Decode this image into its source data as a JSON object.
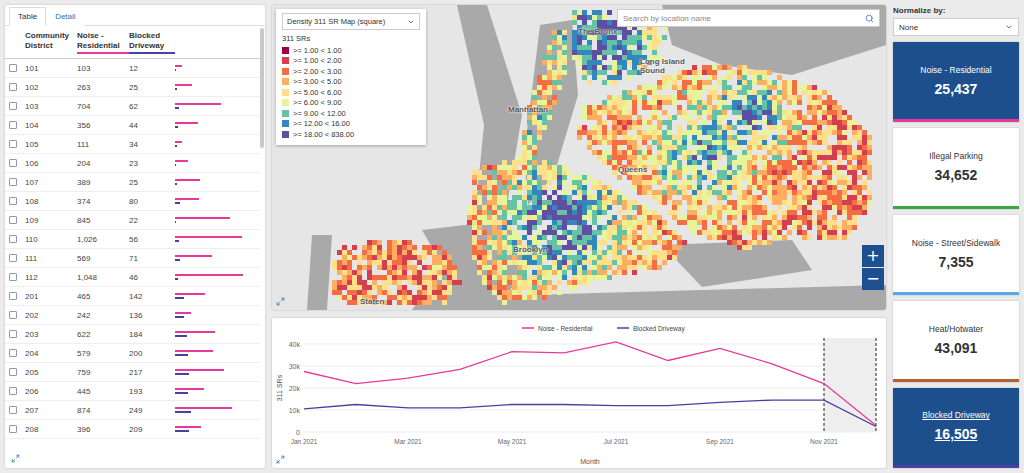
{
  "left_panel": {
    "tabs": [
      {
        "label": "Table",
        "selected": true
      },
      {
        "label": "Detail",
        "selected": false
      }
    ]
  },
  "table": {
    "columns": [
      {
        "label": "Community District"
      },
      {
        "label": "Noise - Residential",
        "color": "#e8399b"
      },
      {
        "label": "Blocked Driveway",
        "color": "#4b3fa0"
      }
    ],
    "rows": [
      {
        "district": "101",
        "noise": "103",
        "blocked": "12",
        "checked": false
      },
      {
        "district": "102",
        "noise": "263",
        "blocked": "25",
        "checked": false
      },
      {
        "district": "103",
        "noise": "704",
        "blocked": "62",
        "checked": false
      },
      {
        "district": "104",
        "noise": "356",
        "blocked": "44",
        "checked": false
      },
      {
        "district": "105",
        "noise": "111",
        "blocked": "34",
        "checked": false
      },
      {
        "district": "106",
        "noise": "204",
        "blocked": "23",
        "checked": false
      },
      {
        "district": "107",
        "noise": "389",
        "blocked": "25",
        "checked": false
      },
      {
        "district": "108",
        "noise": "374",
        "blocked": "80",
        "checked": false
      },
      {
        "district": "109",
        "noise": "845",
        "blocked": "22",
        "checked": false
      },
      {
        "district": "110",
        "noise": "1,026",
        "blocked": "56",
        "checked": false
      },
      {
        "district": "111",
        "noise": "569",
        "blocked": "71",
        "checked": false
      },
      {
        "district": "112",
        "noise": "1,048",
        "blocked": "46",
        "checked": false
      },
      {
        "district": "201",
        "noise": "465",
        "blocked": "142",
        "checked": false
      },
      {
        "district": "202",
        "noise": "242",
        "blocked": "136",
        "checked": false
      },
      {
        "district": "203",
        "noise": "622",
        "blocked": "184",
        "checked": false
      },
      {
        "district": "204",
        "noise": "579",
        "blocked": "200",
        "checked": false
      },
      {
        "district": "205",
        "noise": "759",
        "blocked": "217",
        "checked": false
      },
      {
        "district": "206",
        "noise": "445",
        "blocked": "193",
        "checked": false
      },
      {
        "district": "207",
        "noise": "874",
        "blocked": "249",
        "checked": false
      },
      {
        "district": "208",
        "noise": "396",
        "blocked": "209",
        "checked": false
      }
    ]
  },
  "map": {
    "layer_select": "Density 311 SR Map (square)",
    "legend_title": "311 SRs",
    "legend": [
      {
        "label": ">= 1.00 < 1.00",
        "color": "#9e0142"
      },
      {
        "label": ">= 1.00 < 2.00",
        "color": "#d53e4f"
      },
      {
        "label": ">= 2.00 < 3.00",
        "color": "#f46d43"
      },
      {
        "label": ">= 3.00 < 5.00",
        "color": "#fdae61"
      },
      {
        "label": ">= 5.00 < 6.00",
        "color": "#fee08b"
      },
      {
        "label": ">= 6.00 < 9.00",
        "color": "#e6f598"
      },
      {
        "label": ">= 9.00 < 12.00",
        "color": "#66c2a5"
      },
      {
        "label": ">= 12.00 < 16.00",
        "color": "#3288bd"
      },
      {
        "label": ">= 18.00 < 838.00",
        "color": "#5e4fa2"
      }
    ],
    "search": {
      "placeholder": "Search by location name"
    },
    "labels": [
      "The Bronx",
      "Long Island Sound",
      "Manhattan",
      "Queens",
      "Brooklyn",
      "Staten"
    ],
    "zoom": [
      "+",
      "−"
    ]
  },
  "chart": {
    "series": [
      {
        "label": "Noise - Residential",
        "color": "#e8399b",
        "values": [
          27500,
          22000,
          24500,
          28500,
          36500,
          36000,
          41000,
          32500,
          38000,
          31000,
          22000,
          3000
        ]
      },
      {
        "label": "Blocked Driveway",
        "color": "#4b3fa0",
        "values": [
          10500,
          12500,
          11000,
          11000,
          12500,
          12500,
          12000,
          12000,
          13500,
          14500,
          14500,
          2500
        ]
      }
    ],
    "y_ticks": [
      "0",
      "10k",
      "20k",
      "30k",
      "40k"
    ],
    "y_title": "311 SRs",
    "x_ticks": [
      "Jan 2021",
      "Mar 2021",
      "May 2021",
      "Jul 2021",
      "Sep 2021",
      "Nov 2021"
    ],
    "x_title": "Month",
    "shaded_range": {
      "from": 10,
      "to": 11
    }
  },
  "right_panel": {
    "normalize_label": "Normalize by:",
    "normalize_value": "None",
    "cards": [
      {
        "label": "Noise - Residential",
        "value": "25,437",
        "selected": true,
        "hovered": false,
        "color": "#e8399b"
      },
      {
        "label": "Illegal Parking",
        "value": "34,652",
        "selected": false,
        "hovered": false,
        "color": "#3aa745"
      },
      {
        "label": "Noise - Street/Sidewalk",
        "value": "7,355",
        "selected": false,
        "hovered": false,
        "color": "#5aa9e6"
      },
      {
        "label": "Heat/Hotwater",
        "value": "43,091",
        "selected": false,
        "hovered": false,
        "color": "#b0613a"
      },
      {
        "label": "Blocked Driveway",
        "value": "16,505",
        "selected": true,
        "hovered": true,
        "color": "#4b3fa0"
      }
    ]
  }
}
